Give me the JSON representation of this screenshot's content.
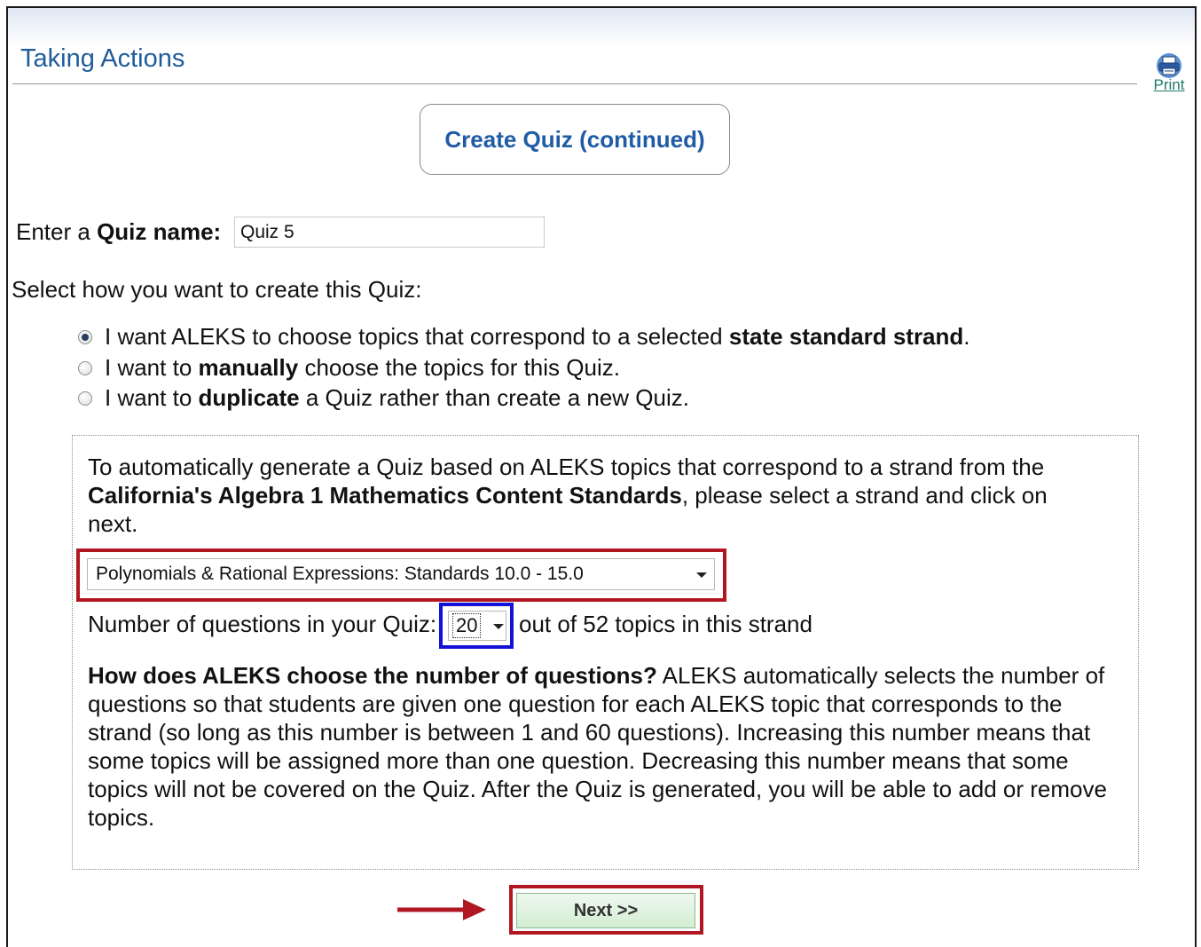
{
  "page": {
    "title": "Taking Actions",
    "print_label": "Print",
    "icons": {
      "print": "printer-icon"
    }
  },
  "create_quiz": {
    "heading": "Create Quiz (continued)"
  },
  "quiz_name": {
    "label_prefix": "Enter a ",
    "label_bold": "Quiz name:",
    "value": "Quiz 5"
  },
  "creation_method": {
    "prompt": "Select how you want to create this Quiz:",
    "options": [
      {
        "pre": "I want ALEKS to choose topics that correspond to a selected ",
        "bold": "state standard strand",
        "post": ".",
        "selected": true
      },
      {
        "pre": "I want to ",
        "bold": "manually",
        "post": " choose the topics for this Quiz.",
        "selected": false
      },
      {
        "pre": "I want to ",
        "bold": "duplicate",
        "post": " a Quiz rather than create a new Quiz.",
        "selected": false
      }
    ]
  },
  "strand_panel": {
    "intro_pre": "To automatically generate a Quiz based on ALEKS topics that correspond to a strand from the ",
    "intro_bold": "California's Algebra 1 Mathematics Content Standards",
    "intro_post": ", please select a strand and click on next.",
    "strand_selected": "Polynomials & Rational Expressions: Standards 10.0 - 15.0",
    "num_questions_label": "Number of questions in your Quiz:",
    "num_questions_value": "20",
    "num_questions_suffix": "out of 52 topics in this strand",
    "explain_question": "How does ALEKS choose the number of questions?",
    "explain_body": " ALEKS automatically selects the number of questions so that students are given one question for each ALEKS topic that corresponds to the strand (so long as this number is between 1 and 60 questions). Increasing this number means that some topics will be assigned more than one question. Decreasing this number means that some topics will not be covered on the Quiz. After the Quiz is generated, you will be able to add or remove topics."
  },
  "actions": {
    "next_label": "Next >>"
  },
  "colors": {
    "title_blue": "#1f5c9c",
    "highlight_red": "#b01722",
    "highlight_blue": "#1212d8",
    "next_green": "#d4edd4"
  }
}
